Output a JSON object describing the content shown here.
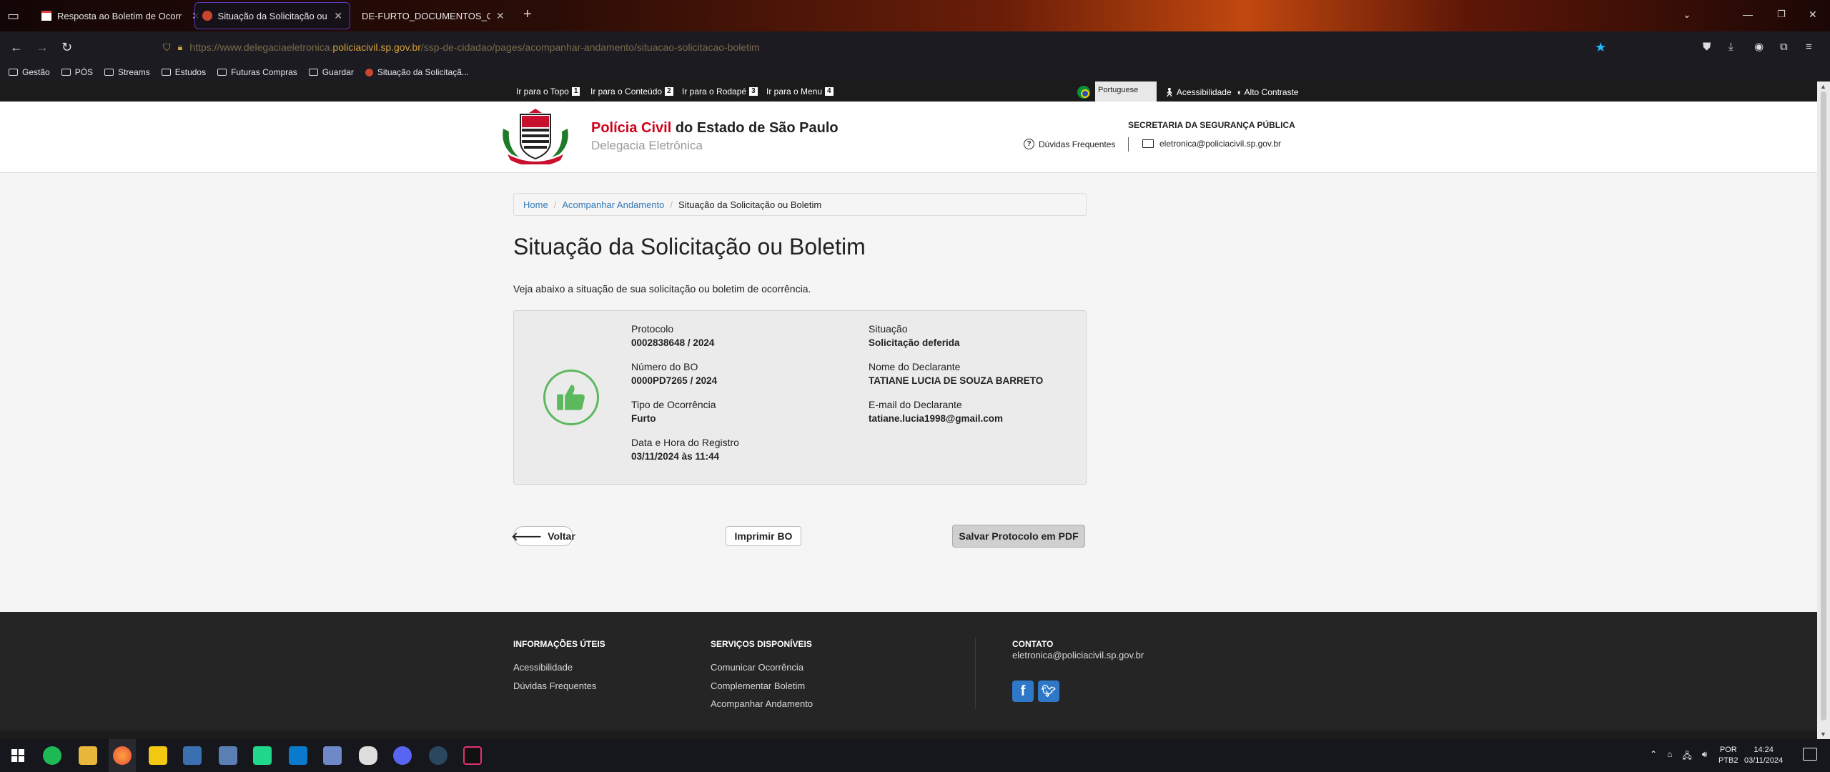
{
  "browser": {
    "tabs": [
      {
        "label": "Resposta ao Boletim de Ocorr"
      },
      {
        "label": "Situação da Solicitação ou Bol"
      },
      {
        "label": "DE-FURTO_DOCUMENTOS_CELULA"
      }
    ],
    "new_tab_label": "+",
    "url_prefix": "https://www.delegaciaeletronica.",
    "url_domain": "policiacivil.sp.gov.br",
    "url_path": "/ssp-de-cidadao/pages/acompanhar-andamento/situacao-solicitacao-boletim",
    "bookmarks": [
      "Gestão",
      "PÓS",
      "Streams",
      "Estudos",
      "Futuras Compras",
      "Guardar",
      "Situação da Solicitaçã..."
    ]
  },
  "access_bar": {
    "skip_links": [
      {
        "label": "Ir para o Topo",
        "key": "1"
      },
      {
        "label": "Ir para o Conteúdo",
        "key": "2"
      },
      {
        "label": "Ir para o Rodapé",
        "key": "3"
      },
      {
        "label": "Ir para o Menu",
        "key": "4"
      }
    ],
    "language": "Portuguese",
    "accessibility": "Acessibilidade",
    "high_contrast": "Alto Contraste"
  },
  "header": {
    "brand_red": "Polícia Civil",
    "brand_rest": " do Estado de São Paulo",
    "brand_sub": "Delegacia Eletrônica",
    "secretaria": "SECRETARIA DA SEGURANÇA PÚBLICA",
    "faq": "Dúvidas Frequentes",
    "email": "eletronica@policiacivil.sp.gov.br"
  },
  "breadcrumb": {
    "home": "Home",
    "level2": "Acompanhar Andamento",
    "current": "Situação da Solicitação ou Boletim"
  },
  "main": {
    "title": "Situação da Solicitação ou Boletim",
    "intro": "Veja abaixo a situação de sua solicitação ou boletim de ocorrência.",
    "fields": {
      "protocolo_label": "Protocolo",
      "protocolo_value": "0002838648 / 2024",
      "bo_label": "Número do BO",
      "bo_value": "0000PD7265 / 2024",
      "tipo_label": "Tipo de Ocorrência",
      "tipo_value": "Furto",
      "data_label": "Data e Hora do Registro",
      "data_value": "03/11/2024 às 11:44",
      "situacao_label": "Situação",
      "situacao_value": "Solicitação deferida",
      "declarante_label": "Nome do Declarante",
      "declarante_value": "TATIANE LUCIA DE SOUZA BARRETO",
      "email_label": "E-mail do Declarante",
      "email_value": "tatiane.lucia1998@gmail.com"
    },
    "buttons": {
      "voltar": "Voltar",
      "imprimir": "Imprimir BO",
      "salvar_pdf": "Salvar Protocolo em PDF"
    },
    "status_color": "#5cb85c"
  },
  "footer": {
    "col1_title": "INFORMAÇÕES ÚTEIS",
    "col1_links": [
      "Acessibilidade",
      "Dúvidas Frequentes"
    ],
    "col2_title": "SERVIÇOS DISPONÍVEIS",
    "col2_links": [
      "Comunicar Ocorrência",
      "Complementar Boletim",
      "Acompanhar Andamento"
    ],
    "contact_title": "CONTATO",
    "contact_email": "eletronica@policiacivil.sp.gov.br"
  },
  "taskbar": {
    "lang_top": "POR",
    "lang_bottom": "PTB2",
    "time": "14:24",
    "date": "03/11/2024"
  }
}
